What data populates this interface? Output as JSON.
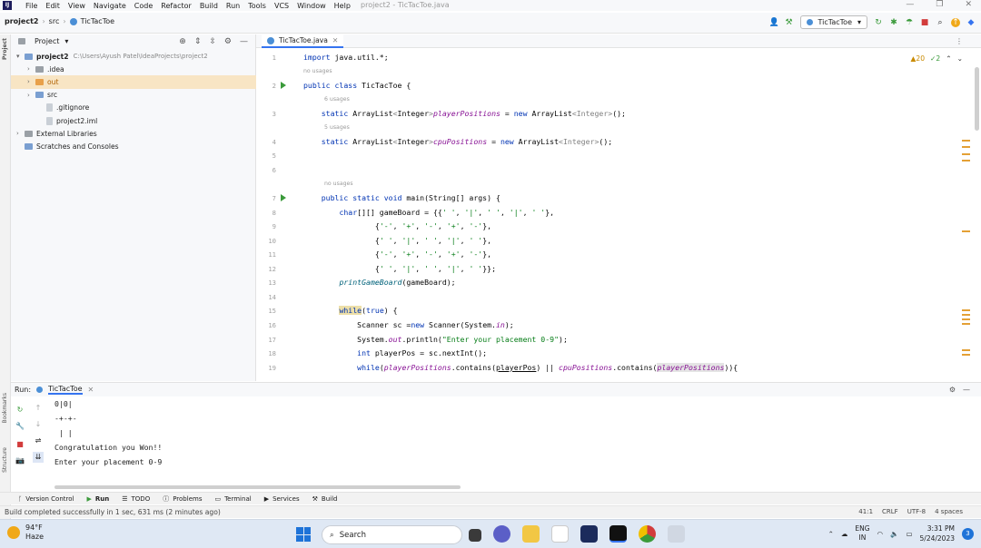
{
  "menubar": {
    "items": [
      "File",
      "Edit",
      "View",
      "Navigate",
      "Code",
      "Refactor",
      "Build",
      "Run",
      "Tools",
      "VCS",
      "Window",
      "Help"
    ],
    "window_title": "project2 - TicTacToe.java",
    "controls": [
      "—",
      "❐",
      "✕"
    ]
  },
  "navbar": {
    "crumbs": [
      "project2",
      "src",
      "TicTacToe"
    ],
    "run_config": "TicTacToe"
  },
  "left_strip": {
    "top": "Project",
    "bottom1": "Bookmarks",
    "bottom2": "Structure"
  },
  "project": {
    "title": "Project",
    "tree": [
      {
        "label": "project2",
        "extra": "C:\\Users\\Ayush Patel\\IdeaProjects\\project2",
        "indent": 0,
        "caret": "▾",
        "icon": "folder-blue",
        "bold": true
      },
      {
        "label": ".idea",
        "indent": 1,
        "caret": "›",
        "icon": "folder-grey"
      },
      {
        "label": "out",
        "indent": 1,
        "caret": "›",
        "icon": "folder-orange",
        "selected": true
      },
      {
        "label": "src",
        "indent": 1,
        "caret": "›",
        "icon": "folder-blue"
      },
      {
        "label": ".gitignore",
        "indent": 2,
        "caret": "",
        "icon": "file"
      },
      {
        "label": "project2.iml",
        "indent": 2,
        "caret": "",
        "icon": "file"
      },
      {
        "label": "External Libraries",
        "indent": 0,
        "caret": "›",
        "icon": "library"
      },
      {
        "label": "Scratches and Consoles",
        "indent": 0,
        "caret": "",
        "icon": "scratches"
      }
    ]
  },
  "editor": {
    "tab": "TicTacToe.java",
    "warnings": "▲20",
    "checks": "✓2",
    "usage_hints": [
      "no usages",
      "6 usages",
      "5 usages",
      "no usages"
    ],
    "line_numbers": [
      "1",
      "2",
      "3",
      "4",
      "5",
      "6",
      "7",
      "8",
      "9",
      "10",
      "11",
      "12",
      "13",
      "14",
      "15",
      "16",
      "17",
      "18",
      "19"
    ]
  },
  "run": {
    "label": "Run:",
    "tab": "TicTacToe",
    "console": [
      "0|0|",
      "-+-+-",
      " | |",
      "Congratulation you Won!!",
      "Enter your placement 0-9"
    ]
  },
  "tool_windows": [
    "Version Control",
    "Run",
    "TODO",
    "Problems",
    "Terminal",
    "Services",
    "Build"
  ],
  "status": {
    "message": "Build completed successfully in 1 sec, 631 ms (2 minutes ago)",
    "position": "41:1",
    "line_sep": "CRLF",
    "encoding": "UTF-8",
    "indent": "4 spaces"
  },
  "taskbar": {
    "temp": "94°F",
    "weather": "Haze",
    "search_placeholder": "Search",
    "lang": "ENG",
    "region": "IN",
    "time": "3:31 PM",
    "date": "5/24/2023",
    "notif_count": "3"
  },
  "colors": {
    "accent": "#3574f0",
    "keyword": "#0033b3",
    "field": "#871094",
    "string": "#067d17",
    "warning": "#e4a035"
  }
}
